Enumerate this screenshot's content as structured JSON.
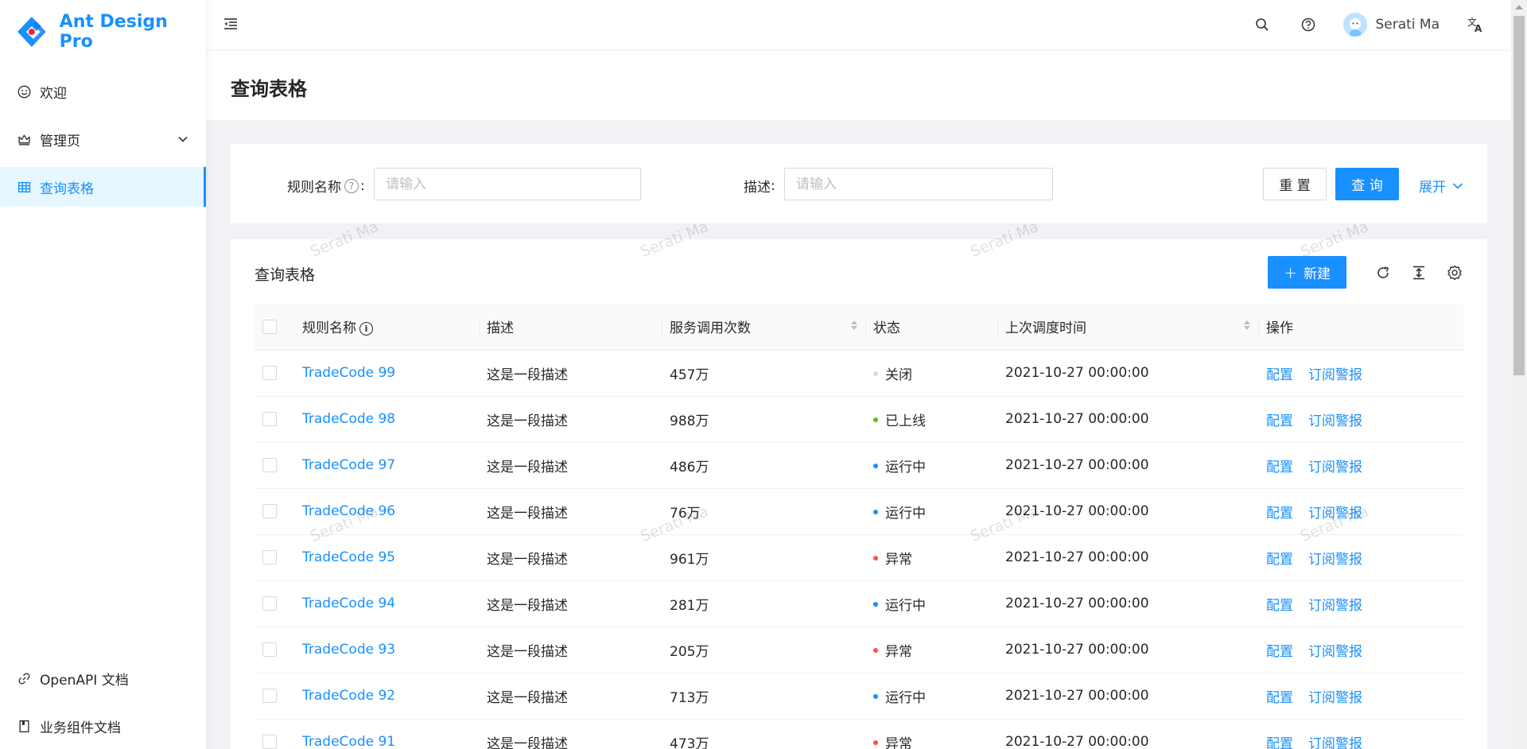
{
  "app": {
    "logo_text": "Ant Design Pro"
  },
  "sidebar": {
    "items": [
      {
        "label": "欢迎",
        "icon": "smile-icon"
      },
      {
        "label": "管理页",
        "icon": "crown-icon"
      },
      {
        "label": "查询表格",
        "icon": "table-icon",
        "active": true
      }
    ],
    "bottom_items": [
      {
        "label": "OpenAPI 文档",
        "icon": "link-icon"
      },
      {
        "label": "业务组件文档",
        "icon": "book-icon"
      }
    ]
  },
  "header": {
    "user_name": "Serati Ma"
  },
  "page": {
    "title": "查询表格"
  },
  "search_form": {
    "rule_name_label": "规则名称",
    "rule_name_placeholder": "请输入",
    "desc_label": "描述",
    "desc_placeholder": "请输入",
    "reset_label": "重 置",
    "query_label": "查 询",
    "expand_label": "展开"
  },
  "table": {
    "title": "查询表格",
    "new_label": "新建",
    "columns": [
      "规则名称",
      "描述",
      "服务调用次数",
      "状态",
      "上次调度时间",
      "操作"
    ],
    "action_config": "配置",
    "action_subscribe": "订阅警报",
    "rows": [
      {
        "name": "TradeCode 99",
        "desc": "这是一段描述",
        "calls": "457万",
        "status": "关闭",
        "status_color": "#d9d9d9",
        "time": "2021-10-27 00:00:00"
      },
      {
        "name": "TradeCode 98",
        "desc": "这是一段描述",
        "calls": "988万",
        "status": "已上线",
        "status_color": "#52c41a",
        "time": "2021-10-27 00:00:00"
      },
      {
        "name": "TradeCode 97",
        "desc": "这是一段描述",
        "calls": "486万",
        "status": "运行中",
        "status_color": "#1890ff",
        "time": "2021-10-27 00:00:00"
      },
      {
        "name": "TradeCode 96",
        "desc": "这是一段描述",
        "calls": "76万",
        "status": "运行中",
        "status_color": "#1890ff",
        "time": "2021-10-27 00:00:00"
      },
      {
        "name": "TradeCode 95",
        "desc": "这是一段描述",
        "calls": "961万",
        "status": "异常",
        "status_color": "#ff4d4f",
        "time": "2021-10-27 00:00:00"
      },
      {
        "name": "TradeCode 94",
        "desc": "这是一段描述",
        "calls": "281万",
        "status": "运行中",
        "status_color": "#1890ff",
        "time": "2021-10-27 00:00:00"
      },
      {
        "name": "TradeCode 93",
        "desc": "这是一段描述",
        "calls": "205万",
        "status": "异常",
        "status_color": "#ff4d4f",
        "time": "2021-10-27 00:00:00"
      },
      {
        "name": "TradeCode 92",
        "desc": "这是一段描述",
        "calls": "713万",
        "status": "运行中",
        "status_color": "#1890ff",
        "time": "2021-10-27 00:00:00"
      },
      {
        "name": "TradeCode 91",
        "desc": "这是一段描述",
        "calls": "473万",
        "status": "异常",
        "status_color": "#ff4d4f",
        "time": "2021-10-27 00:00:00"
      }
    ]
  },
  "watermark": {
    "text": "Serati Ma"
  },
  "colors": {
    "primary": "#1890ff",
    "success": "#52c41a",
    "error": "#ff4d4f",
    "default": "#d9d9d9"
  }
}
